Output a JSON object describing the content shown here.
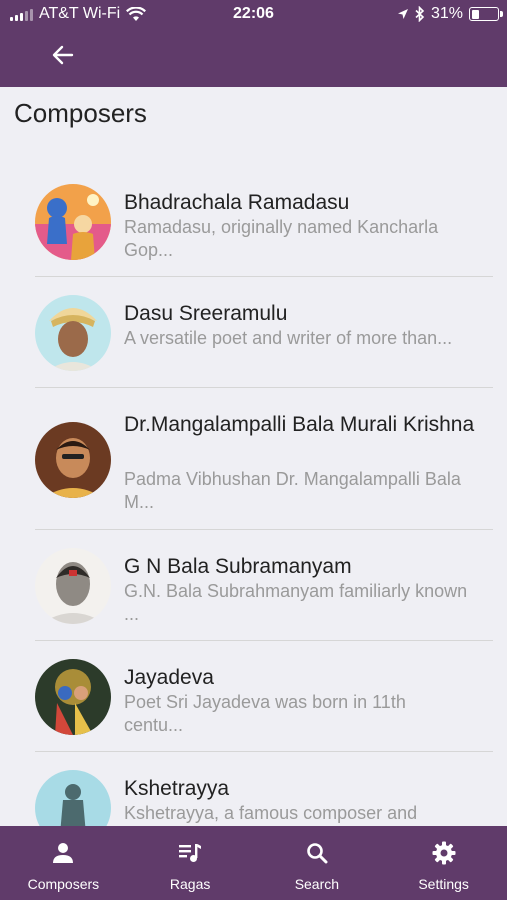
{
  "status_bar": {
    "carrier": "AT&T Wi-Fi",
    "time": "22:06",
    "battery": "31%",
    "battery_level": 0.31
  },
  "nav": {
    "back_icon": "arrow-left-icon"
  },
  "page": {
    "title": "Composers"
  },
  "composers": [
    {
      "name": "Bhadrachala Ramadasu",
      "description": "Ramadasu, originally named Kancharla Gop..."
    },
    {
      "name": "Dasu Sreeramulu",
      "description": "A versatile poet and writer of more than..."
    },
    {
      "name": "Dr.Mangalampalli Bala Murali Krishna",
      "description": "Padma Vibhushan Dr. Mangalampalli Bala M..."
    },
    {
      "name": "G N Bala Subramanyam",
      "description": "G.N. Bala Subrahmanyam familiarly known ..."
    },
    {
      "name": "Jayadeva",
      "description": "Poet Sri Jayadeva was born in 11th centu..."
    },
    {
      "name": "Kshetrayya",
      "description": "Kshetrayya, a famous composer and"
    }
  ],
  "tabs": [
    {
      "label": "Composers",
      "icon": "person-icon"
    },
    {
      "label": "Ragas",
      "icon": "music-list-icon"
    },
    {
      "label": "Search",
      "icon": "search-icon"
    },
    {
      "label": "Settings",
      "icon": "gear-icon"
    }
  ],
  "colors": {
    "bar": "#603b6a",
    "background": "#efeff4",
    "title": "#222222",
    "subtitle": "#9a9a9a"
  }
}
